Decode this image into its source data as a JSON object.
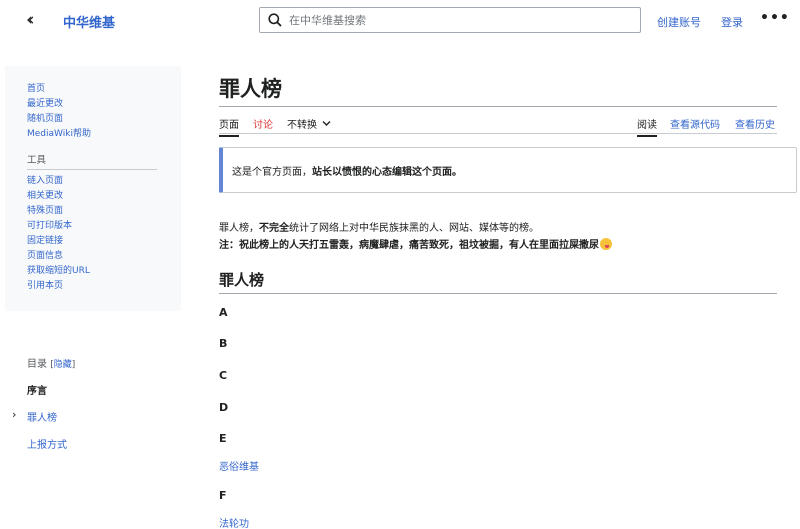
{
  "header": {
    "logo": "中华维基",
    "search_placeholder": "在中华维基搜索",
    "create_account": "创建账号",
    "login": "登录",
    "more": "•••"
  },
  "sidebar": {
    "nav": [
      "首页",
      "最近更改",
      "随机页面",
      "MediaWiki帮助"
    ],
    "tools_heading": "工具",
    "tools": [
      "链入页面",
      "相关更改",
      "特殊页面",
      "可打印版本",
      "固定链接",
      "页面信息",
      "获取缩短的URL",
      "引用本页"
    ]
  },
  "toc": {
    "title": "目录",
    "hide_open": "[",
    "hide_label": "隐藏",
    "hide_close": "]",
    "items": [
      "序言",
      "罪人榜",
      "上报方式"
    ]
  },
  "page": {
    "title": "罪人榜",
    "tabs": {
      "page": "页面",
      "talk": "讨论",
      "variant": "不转换",
      "read": "阅读",
      "view_source": "查看源代码",
      "history": "查看历史"
    },
    "notice_prefix": "这是个官方页面，",
    "notice_bold": "站长以愤恨的心态编辑这个页面。",
    "intro_1": "罪人榜，",
    "intro_bold": "不完全",
    "intro_2": "统计了网络上对中华民族抹黑的人、网站、媒体等的榜。",
    "note": "注：祝此榜上的人天打五雷轰，病魔肆虐，痛苦致死，祖坟被掘，有人在里面拉屎撒尿",
    "section_heading": "罪人榜",
    "letters": [
      "A",
      "B",
      "C",
      "D",
      "E",
      "F"
    ],
    "entry_e": "恶俗维基",
    "entry_f": "法轮功"
  }
}
